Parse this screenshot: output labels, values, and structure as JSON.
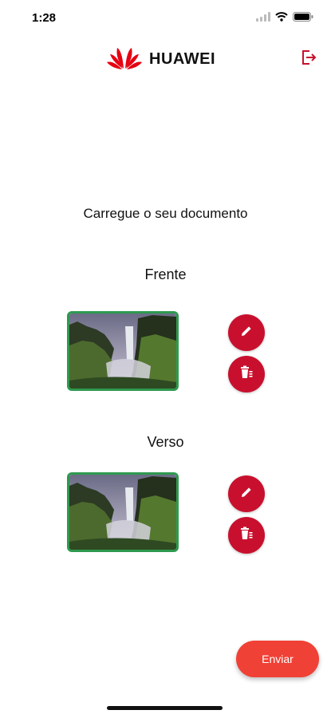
{
  "status_bar": {
    "time": "1:28"
  },
  "header": {
    "brand": "HUAWEI",
    "brand_color": "#e60012",
    "logout_icon": "logout-icon"
  },
  "instruction": "Carregue o seu documento",
  "front": {
    "label": "Frente",
    "edit_icon": "pencil-icon",
    "delete_icon": "trash-icon"
  },
  "back": {
    "label": "Verso",
    "edit_icon": "pencil-icon",
    "delete_icon": "trash-icon"
  },
  "colors": {
    "action_red": "#c8102e",
    "send_red": "#f04136",
    "thumb_border": "#2e9a4f"
  },
  "submit": {
    "label": "Enviar"
  }
}
